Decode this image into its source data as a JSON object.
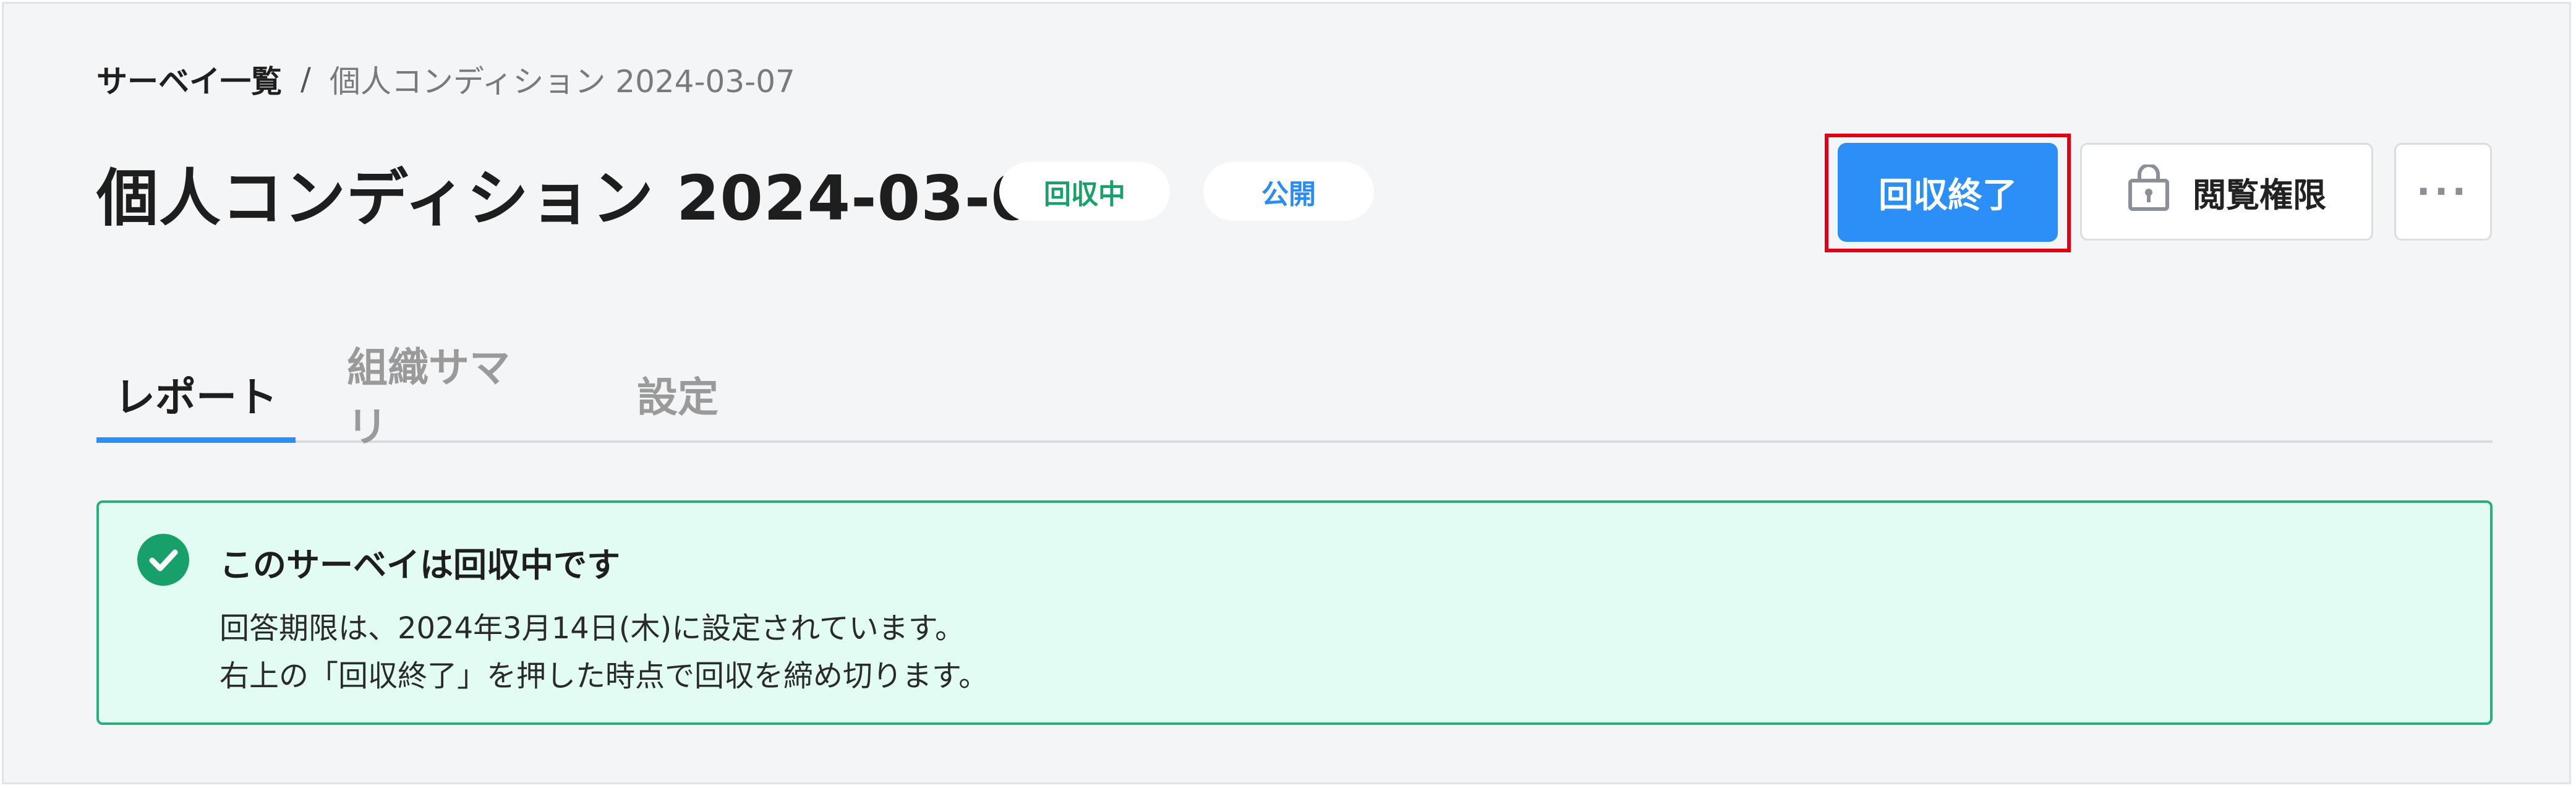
{
  "breadcrumb": {
    "root": "サーベイ一覧",
    "separator": "/",
    "current": "個人コンディション 2024-03-07"
  },
  "header": {
    "title": "個人コンディション 2024-03-07",
    "badges": {
      "status": "回収中",
      "visibility": "公開"
    },
    "actions": {
      "close_collection": "回収終了",
      "view_permission": "閲覧権限",
      "more": "···"
    }
  },
  "tabs": [
    {
      "label": "レポート",
      "active": true
    },
    {
      "label": "組織サマリ",
      "active": false
    },
    {
      "label": "設定",
      "active": false
    }
  ],
  "notice": {
    "icon": "check-circle-icon",
    "title": "このサーベイは回収中です",
    "line1": "回答期限は、2024年3月14日(木)に設定されています。",
    "line2": "右上の「回収終了」を押した時点で回収を締め切ります。"
  },
  "colors": {
    "primary": "#2b8ff7",
    "success": "#17a06a",
    "notice_bg": "#e2fcf3",
    "highlight": "#e20012"
  }
}
